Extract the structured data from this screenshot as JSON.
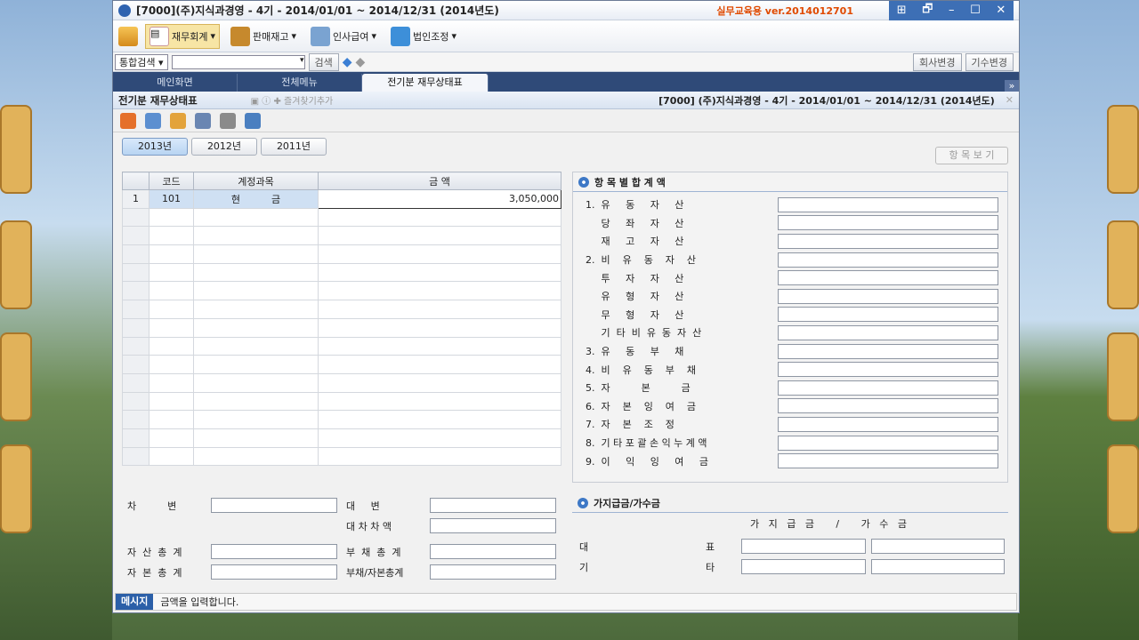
{
  "window": {
    "title": "[7000](주)지식과경영 - 4기 - 2014/01/01 ~ 2014/12/31 (2014년도)",
    "version": "실무교육용 ver.2014012701",
    "controls": [
      "⊞",
      "🗗",
      "–",
      "☐",
      "✕"
    ]
  },
  "toolbar": {
    "items": [
      {
        "label": "재무회계",
        "icon": "ledger-icon"
      },
      {
        "label": "판매재고",
        "icon": "box-icon"
      },
      {
        "label": "인사급여",
        "icon": "people-icon"
      },
      {
        "label": "법인조정",
        "icon": "building-icon"
      }
    ]
  },
  "search": {
    "select": "통합검색",
    "button": "검색",
    "company_btn": "회사변경",
    "period_btn": "기수변경"
  },
  "tabs": {
    "main": "메인화면",
    "menu": "전체메뉴",
    "current": "전기분 재무상태표",
    "more": "»"
  },
  "subheader": {
    "name": "전기분 재무상태표",
    "hint": "즐겨찾기추가",
    "company_info": "[7000] (주)지식과경영 - 4기 - 2014/01/01 ~ 2014/12/31 (2014년도)"
  },
  "years": [
    "2013년",
    "2012년",
    "2011년"
  ],
  "view_button": "항 목 보 기",
  "grid": {
    "headers": [
      "코드",
      "계정과목",
      "금          액"
    ],
    "rows": [
      {
        "no": "1",
        "code": "101",
        "name": "현          금",
        "amount": "3,050,000"
      }
    ]
  },
  "panel": {
    "title": "항 목 별 합 계 액",
    "items": [
      "1.  유     동     자     산",
      "     당     좌     자     산",
      "     재     고     자     산",
      "2.  비    유    동    자    산",
      "     투     자     자     산",
      "     유     형     자     산",
      "     무     형     자     산",
      "     기  타  비  유  동  자  산",
      "3.  유     동     부     채",
      "4.  비    유    동    부    채",
      "5.  자          본          금",
      "6.  자    본    잉    여    금",
      "7.  자    본    조    정",
      "8.  기 타 포 괄 손 익 누 계 액",
      "9.  이     익     잉     여     금"
    ]
  },
  "bottom": {
    "debit": "차          변",
    "credit": "대     변",
    "diff": "대 차 차 액",
    "assets": "자  산  총  계",
    "liab": "부  채  총  계",
    "capital": "자  본  총  계",
    "liabcap": "부채/자본총계"
  },
  "suspense": {
    "title": "가지급금/가수금",
    "header": "가   지   급   금       /       가   수   금",
    "rep": "대",
    "rep2": "표",
    "etc": "기",
    "etc2": "타"
  },
  "message": {
    "badge": "메시지",
    "text": "금액을 입력합니다."
  }
}
